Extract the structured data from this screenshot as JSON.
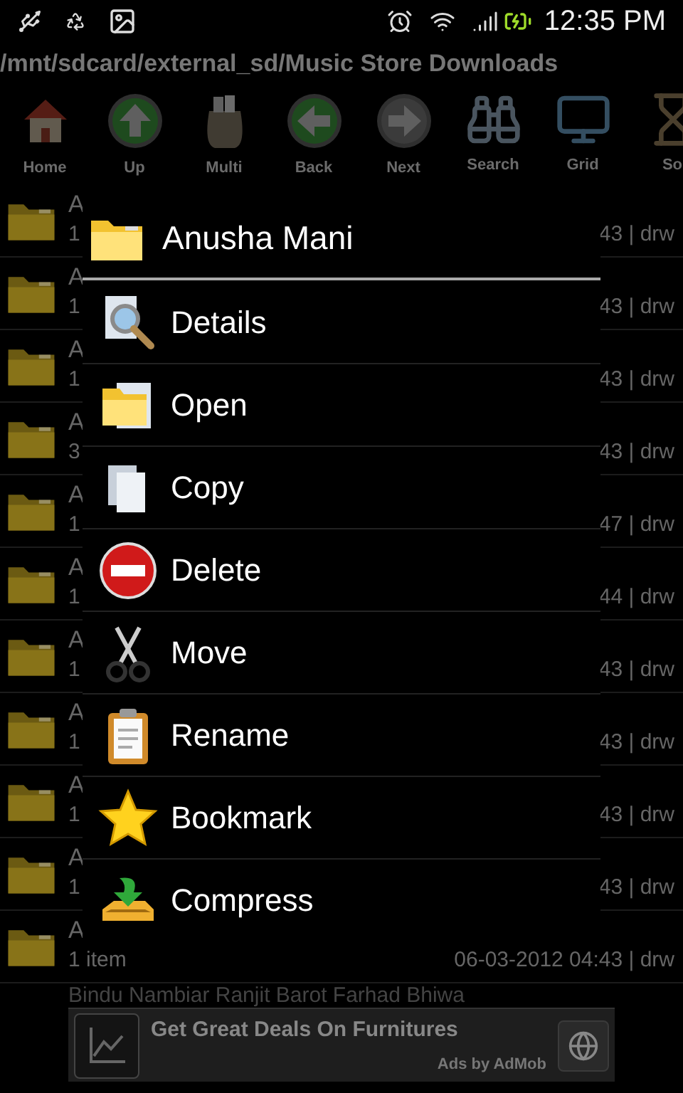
{
  "status_bar": {
    "time": "12:35 PM"
  },
  "path": "/mnt/sdcard/external_sd/Music Store Downloads",
  "toolbar": [
    {
      "kind": "home",
      "label": "Home"
    },
    {
      "kind": "up",
      "label": "Up"
    },
    {
      "kind": "multi",
      "label": "Multi"
    },
    {
      "kind": "back",
      "label": "Back"
    },
    {
      "kind": "next",
      "label": "Next"
    },
    {
      "kind": "search",
      "label": "Search"
    },
    {
      "kind": "grid",
      "label": "Grid"
    },
    {
      "kind": "sort",
      "label": "So"
    }
  ],
  "files": [
    {
      "title": "A",
      "subtitle": "1",
      "info": "43 | drw"
    },
    {
      "title": "A",
      "subtitle": "1",
      "info": "43 | drw"
    },
    {
      "title": "A",
      "subtitle": "1",
      "info": "43 | drw"
    },
    {
      "title": "A",
      "subtitle": "3",
      "info": "43 | drw"
    },
    {
      "title": "A",
      "subtitle": "1",
      "info": "47 | drw"
    },
    {
      "title": "A",
      "subtitle": "1",
      "info": "44 | drw"
    },
    {
      "title": "A",
      "subtitle": "1",
      "info": "43 | drw"
    },
    {
      "title": "A",
      "subtitle": "1",
      "info": "43 | drw"
    },
    {
      "title": "A",
      "subtitle": "1",
      "info": "43 | drw"
    },
    {
      "title": "A",
      "subtitle": "1",
      "info": "43 | drw"
    },
    {
      "title": "A",
      "subtitle": "1 item",
      "info": "06-03-2012 04:43 | drw"
    },
    {
      "title": "Bindu Nambiar Ranjit Barot Farhad Bhiwa"
    }
  ],
  "dialog": {
    "title": "Anusha Mani",
    "items": [
      {
        "kind": "details",
        "label": "Details"
      },
      {
        "kind": "open",
        "label": "Open"
      },
      {
        "kind": "copy",
        "label": "Copy"
      },
      {
        "kind": "delete",
        "label": "Delete"
      },
      {
        "kind": "move",
        "label": "Move"
      },
      {
        "kind": "rename",
        "label": "Rename"
      },
      {
        "kind": "bookmark",
        "label": "Bookmark"
      },
      {
        "kind": "compress",
        "label": "Compress"
      }
    ]
  },
  "ad": {
    "title": "Get Great Deals On Furnitures",
    "footer": "Ads by AdMob"
  }
}
